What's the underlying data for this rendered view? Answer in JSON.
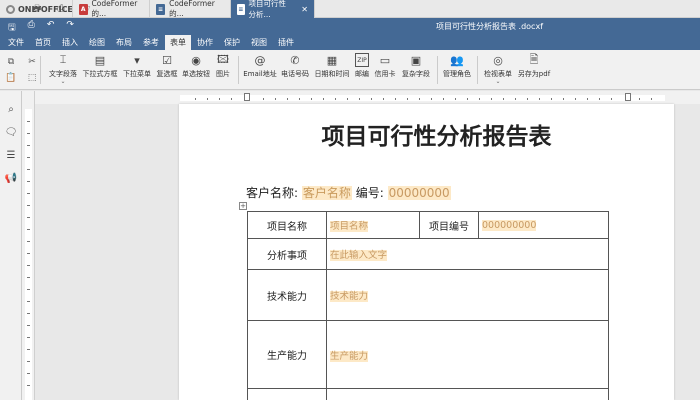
{
  "app": {
    "logo": "ONLYOFFICE",
    "tabs": [
      {
        "label": "CodeFormer的...",
        "icon": "pdf-icon",
        "active": false
      },
      {
        "label": "CodeFormer的...",
        "icon": "document-icon",
        "active": false
      },
      {
        "label": "项目可行性分析...",
        "icon": "document-icon",
        "active": true
      }
    ]
  },
  "header": {
    "doc_title": "项目可行性分析报告表 .docxf"
  },
  "menu": [
    "文件",
    "首页",
    "插入",
    "绘图",
    "布局",
    "参考",
    "表单",
    "协作",
    "保护",
    "视图",
    "插件"
  ],
  "menu_active_index": 6,
  "toolbar": {
    "tools": [
      {
        "label": "文字段落",
        "icon": "text-field-icon",
        "caret": true
      },
      {
        "label": "下拉式方框",
        "icon": "combo-box-icon"
      },
      {
        "label": "下拉菜单",
        "icon": "dropdown-icon"
      },
      {
        "label": "复选框",
        "icon": "checkbox-icon"
      },
      {
        "label": "单选按钮",
        "icon": "radio-icon"
      },
      {
        "label": "图片",
        "icon": "image-icon"
      },
      {
        "label": "Email地址",
        "icon": "at-icon"
      },
      {
        "label": "电话号码",
        "icon": "phone-icon"
      },
      {
        "label": "日期和时间",
        "icon": "calendar-icon"
      },
      {
        "label": "邮编",
        "icon": "zip-icon"
      },
      {
        "label": "信用卡",
        "icon": "credit-card-icon"
      },
      {
        "label": "复杂字段",
        "icon": "complex-field-icon"
      },
      {
        "label": "管理角色",
        "icon": "roles-icon"
      },
      {
        "label": "检视表单",
        "icon": "view-form-icon",
        "caret": true
      },
      {
        "label": "另存为pdf",
        "icon": "save-pdf-icon"
      }
    ]
  },
  "document": {
    "heading": "项目可行性分析报告表",
    "customer_label": "客户名称:",
    "customer_value": "客户名称",
    "number_label": "编号:",
    "number_value": "00000000",
    "table": {
      "row1": {
        "label1": "项目名称",
        "value1": "项目名称",
        "label2": "项目编号",
        "value2": "000000000"
      },
      "row2": {
        "label": "分析事项",
        "value": "在此输入文字"
      },
      "row3": {
        "label": "技术能力",
        "value": "技术能力"
      },
      "row4": {
        "label": "生产能力",
        "value": "生产能力"
      }
    }
  },
  "colors": {
    "brand_blue": "#446995",
    "field_highlight": "#fde9c7",
    "field_text": "#c89a63"
  }
}
